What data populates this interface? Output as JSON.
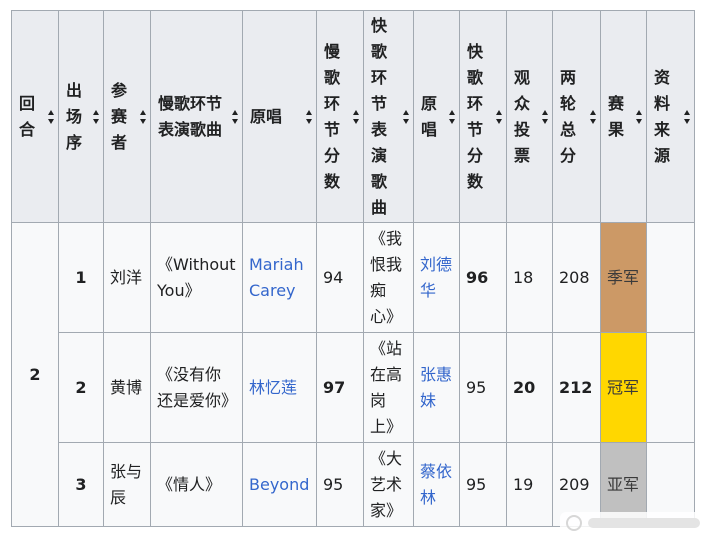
{
  "headers": [
    "回合",
    "出场序",
    "参赛者",
    "慢歌环节表演歌曲",
    "原唱",
    "慢歌环节分数",
    "快歌环节表演歌曲",
    "原唱",
    "快歌环节分数",
    "观众投票",
    "两轮总分",
    "赛果",
    "资料来源"
  ],
  "round": "2",
  "rows": [
    {
      "order": "1",
      "contestant": "刘洋",
      "slow_song": "《Without You》",
      "slow_original": "Mariah Carey",
      "slow_score": "94",
      "fast_song": "《我恨我痴心》",
      "fast_original": "刘德华",
      "fast_score": "96",
      "audience": "18",
      "total": "208",
      "result": "季军",
      "result_color": "#cc9966"
    },
    {
      "order": "2",
      "contestant": "黄博",
      "slow_song": "《没有你还是爱你》",
      "slow_original": "林忆莲",
      "slow_score": "97",
      "fast_song": "《站在高岗上》",
      "fast_original": "张惠妹",
      "fast_score": "95",
      "audience": "20",
      "total": "212",
      "result": "冠军",
      "result_color": "#ffd700"
    },
    {
      "order": "3",
      "contestant": "张与辰",
      "slow_song": "《情人》",
      "slow_original": "Beyond",
      "slow_score": "95",
      "fast_song": "《大艺术家》",
      "fast_original": "蔡依林",
      "fast_score": "95",
      "audience": "19",
      "total": "209",
      "result": "亚军",
      "result_color": "#c0c0c0"
    }
  ]
}
